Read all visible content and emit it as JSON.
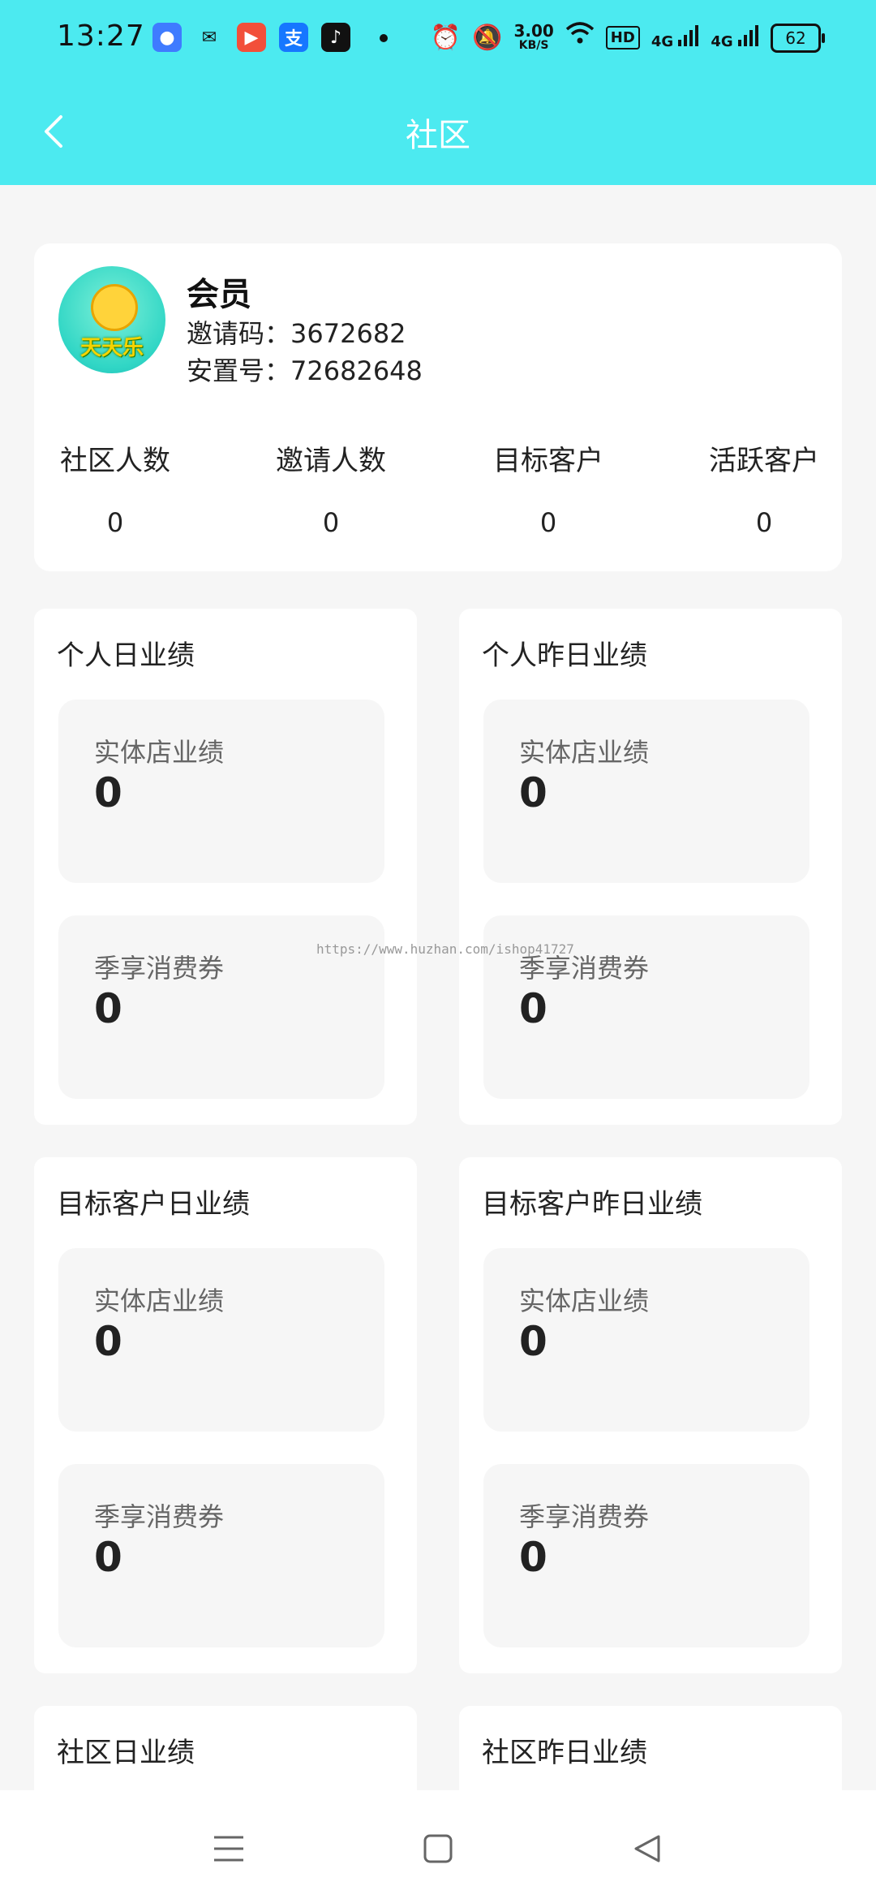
{
  "status_bar": {
    "time": "13:27",
    "speed_value": "3.00",
    "speed_unit": "KB/S",
    "hd": "HD",
    "signal1": "4G",
    "signal2": "4G",
    "battery": "62"
  },
  "header": {
    "title": "社区"
  },
  "member": {
    "avatar_text": "天天乐",
    "name": "会员",
    "invite_label": "邀请码：",
    "invite_code": "3672682",
    "placement_label": "安置号：",
    "placement_code": "72682648"
  },
  "stats": [
    {
      "label": "社区人数",
      "value": "0"
    },
    {
      "label": "邀请人数",
      "value": "0"
    },
    {
      "label": "目标客户",
      "value": "0"
    },
    {
      "label": "活跃客户",
      "value": "0"
    }
  ],
  "perf_cards": [
    {
      "title": "个人日业绩",
      "items": [
        {
          "label": "实体店业绩",
          "value": "0"
        },
        {
          "label": "季享消费券",
          "value": "0"
        }
      ]
    },
    {
      "title": "个人昨日业绩",
      "items": [
        {
          "label": "实体店业绩",
          "value": "0"
        },
        {
          "label": "季享消费券",
          "value": "0"
        }
      ]
    },
    {
      "title": "目标客户日业绩",
      "items": [
        {
          "label": "实体店业绩",
          "value": "0"
        },
        {
          "label": "季享消费券",
          "value": "0"
        }
      ]
    },
    {
      "title": "目标客户昨日业绩",
      "items": [
        {
          "label": "实体店业绩",
          "value": "0"
        },
        {
          "label": "季享消费券",
          "value": "0"
        }
      ]
    },
    {
      "title": "社区日业绩"
    },
    {
      "title": "社区昨日业绩"
    }
  ],
  "watermark": "https://www.huzhan.com/ishop41727"
}
